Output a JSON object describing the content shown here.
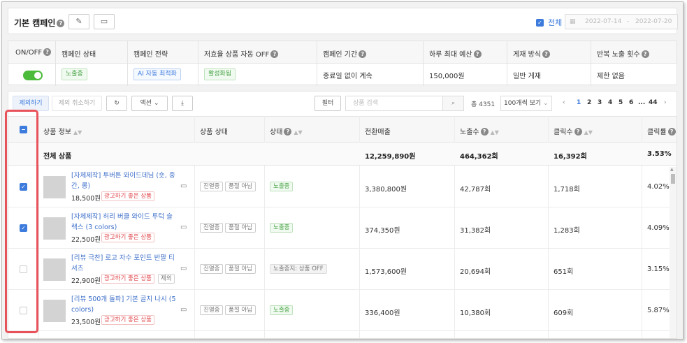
{
  "header": {
    "title": "기본 캠페인",
    "edit_icon": "pencil-icon",
    "cart_icon": "cart-icon",
    "all_label": "전체",
    "all_checked": true,
    "date_start": "2022-07-14",
    "date_sep": "-",
    "date_end": "2022-07-20"
  },
  "campaign_info": {
    "columns": [
      "ON/OFF",
      "캠페인 상태",
      "캠페인 전략",
      "저효율 상품 자동 OFF",
      "캠페인 기간",
      "하루 최대 예산",
      "게재 방식",
      "반복 노출 횟수"
    ],
    "toggle_on": true,
    "status": "노출중",
    "strategy": "AI 자동 최적화",
    "auto_off": "활성화됨",
    "period": "종료일 없이 계속",
    "daily_budget": "150,000원",
    "display_method": "일반 게재",
    "repeat": "제한 없음"
  },
  "toolbar": {
    "exclude": "제외하기",
    "cancel_exclude": "제외 취소하기",
    "refresh_icon": "refresh-icon",
    "action": "액션",
    "download_icon": "download-icon",
    "filter": "필터",
    "search_placeholder": "상품 검색",
    "total": "총 4351",
    "page_size": "100개씩 보기",
    "pages": [
      "1",
      "2",
      "3",
      "4",
      "5",
      "6",
      "...",
      "44"
    ],
    "current_page": "1"
  },
  "table": {
    "columns": [
      "상품 정보",
      "상품 상태",
      "상태",
      "전환매출",
      "노출수",
      "클릭수",
      "클릭률"
    ],
    "summary": {
      "label": "전체 상품",
      "revenue": "12,259,890원",
      "impressions": "464,362회",
      "clicks": "16,392회",
      "ctr": "3.53%"
    },
    "rows": [
      {
        "checked": true,
        "name": "[자체제작] 투버튼 와이드데님 (숏, 중간, 롱)",
        "price": "18,500원",
        "badges": [
          "광고하기 좋은 상품"
        ],
        "stock_tags": [
          "진열중",
          "품절 아님"
        ],
        "status": "노출중",
        "revenue": "3,380,800원",
        "impressions": "42,787회",
        "clicks": "1,718회",
        "ctr": "4.02%"
      },
      {
        "checked": true,
        "name": "[자체제작] 허리 버클 와이드 투턱 슬랙스 (3 colors)",
        "price": "22,500원",
        "badges": [
          "광고하기 좋은 상품"
        ],
        "stock_tags": [
          "진열중",
          "품절 아님"
        ],
        "status": "노출중",
        "revenue": "374,350원",
        "impressions": "31,382회",
        "clicks": "1,283회",
        "ctr": "4.09%"
      },
      {
        "checked": false,
        "name": "[리뷰 극찬] 로고 자수 포인트 반팔 티셔츠",
        "price": "22,900원",
        "badges": [
          "광고하기 좋은 상품",
          "제외"
        ],
        "stock_tags": [
          "진열중",
          "품절 아님"
        ],
        "status": "노출중지: 상품 OFF",
        "revenue": "1,573,600원",
        "impressions": "20,694회",
        "clicks": "651회",
        "ctr": "3.15%"
      },
      {
        "checked": false,
        "name": "[리뷰 500개 돌파] 기본 골지 나시 (5 colors)",
        "price": "23,500원",
        "badges": [
          "광고하기 좋은 상품"
        ],
        "stock_tags": [
          "진열중",
          "품절 아님"
        ],
        "status": "노출중",
        "revenue": "336,400원",
        "impressions": "10,380회",
        "clicks": "609회",
        "ctr": "5.87%"
      }
    ]
  },
  "colors": {
    "accent": "#3d7bdc",
    "green": "#45a344",
    "highlight": "#e8535b"
  }
}
